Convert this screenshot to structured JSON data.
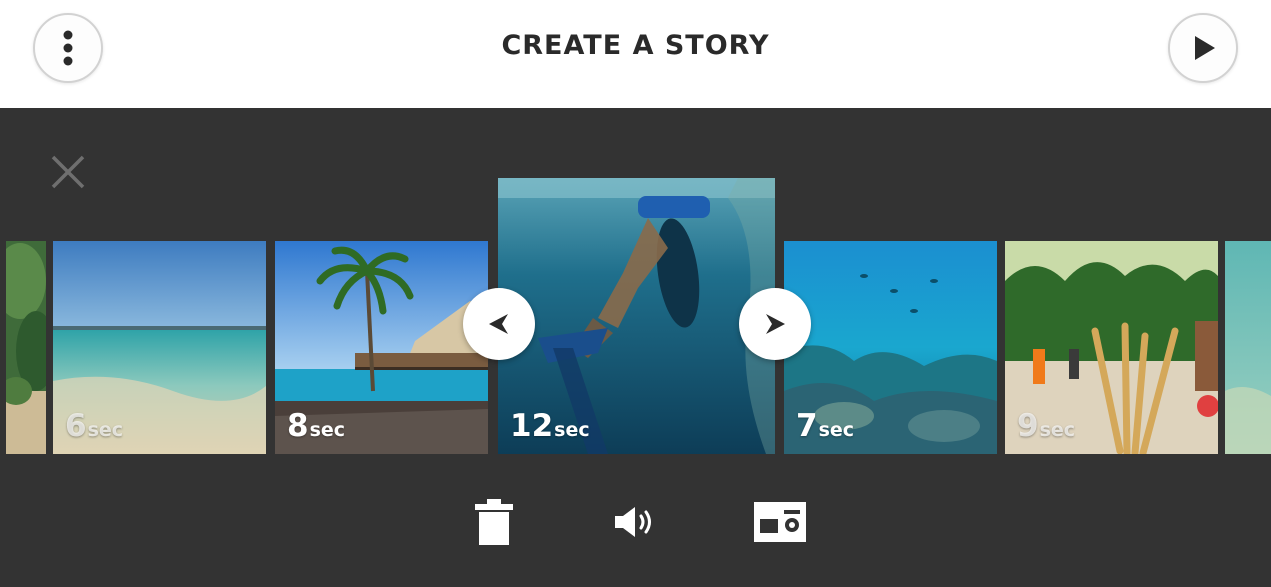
{
  "header": {
    "title": "CREATE A STORY",
    "more_icon": "vertical-dots-icon",
    "play_icon": "play-icon"
  },
  "editor": {
    "close_icon": "close-x-icon",
    "clips": [
      {
        "label": "",
        "scene": "jungle-edge"
      },
      {
        "num": "6",
        "unit": "sec",
        "scene": "shallow-beach"
      },
      {
        "num": "8",
        "unit": "sec",
        "scene": "palm-overwater-villa"
      },
      {
        "num": "12",
        "unit": "sec",
        "scene": "underwater-snorkeler",
        "selected": true
      },
      {
        "num": "7",
        "unit": "sec",
        "scene": "coral-reef"
      },
      {
        "num": "9",
        "unit": "sec",
        "scene": "palm-garden-people"
      },
      {
        "label": "",
        "scene": "turquoise-water"
      }
    ],
    "move_left_icon": "arrow-left-icon",
    "move_right_icon": "arrow-right-icon"
  },
  "toolbar": {
    "delete_icon": "trash-icon",
    "audio_icon": "speaker-icon",
    "layout_icon": "photo-layout-icon"
  },
  "colors": {
    "header_bg": "#ffffff",
    "editor_bg": "#333333",
    "title_text": "#2a2a2a"
  }
}
